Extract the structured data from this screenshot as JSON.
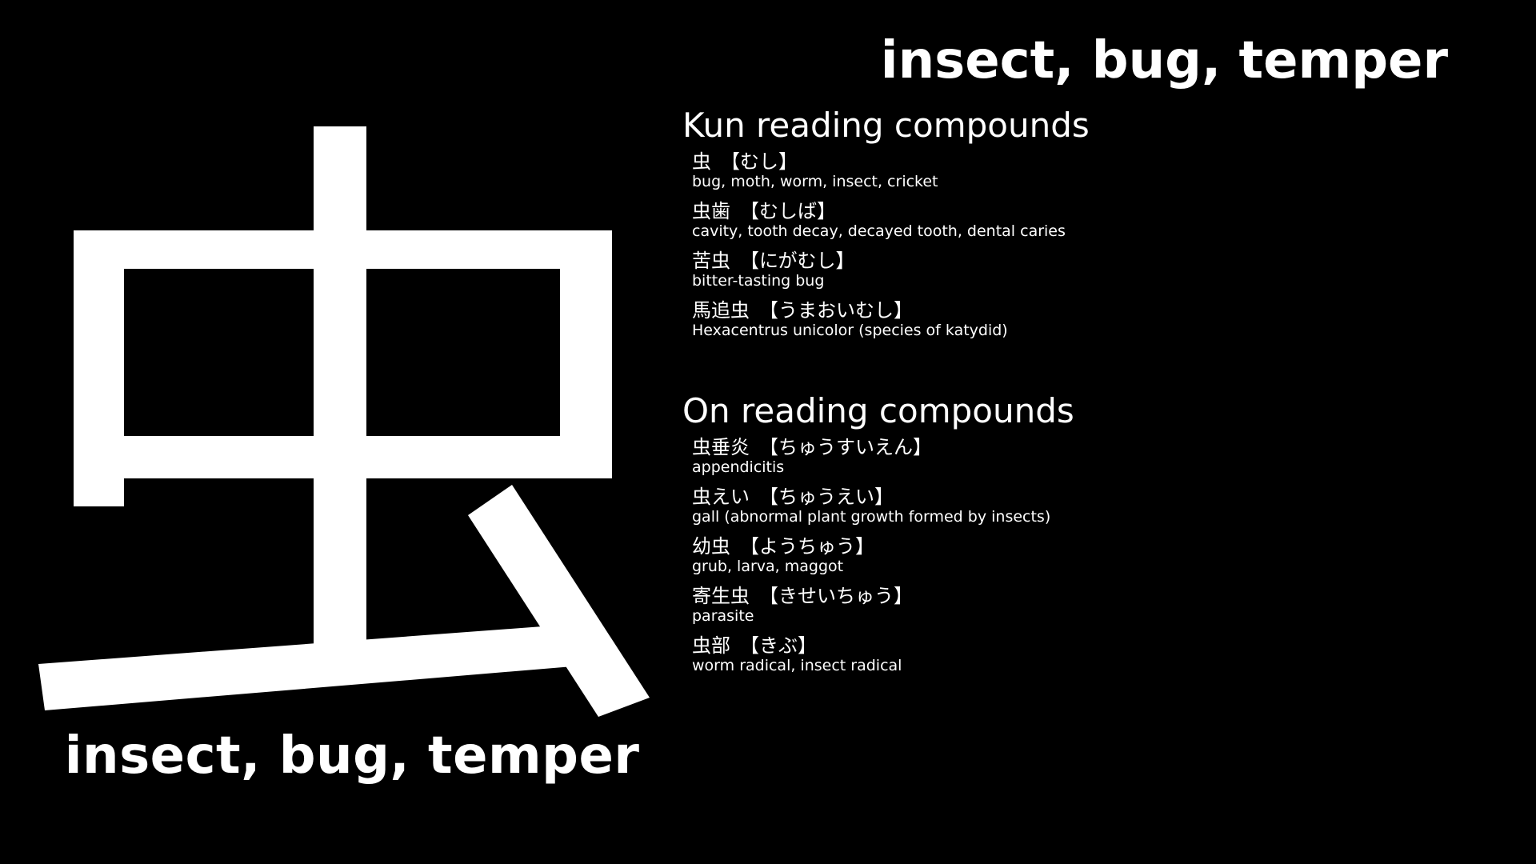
{
  "kanji": {
    "character": "虫",
    "meaning_large": "insect, bug, temper"
  },
  "header": {
    "meaning": "insect, bug, temper"
  },
  "kun_section": {
    "heading": "Kun reading compounds",
    "items": [
      {
        "term": "虫",
        "reading": "【むし】",
        "gloss": "bug, moth, worm, insect, cricket"
      },
      {
        "term": "虫歯",
        "reading": "【むしば】",
        "gloss": "cavity, tooth decay, decayed tooth, dental caries"
      },
      {
        "term": "苦虫",
        "reading": "【にがむし】",
        "gloss": "bitter-tasting bug"
      },
      {
        "term": "馬追虫",
        "reading": "【うまおいむし】",
        "gloss": "Hexacentrus unicolor (species of katydid)"
      }
    ]
  },
  "on_section": {
    "heading": "On reading compounds",
    "items": [
      {
        "term": "虫垂炎",
        "reading": "【ちゅうすいえん】",
        "gloss": "appendicitis"
      },
      {
        "term": "虫えい",
        "reading": "【ちゅうえい】",
        "gloss": "gall (abnormal plant growth formed by insects)"
      },
      {
        "term": "幼虫",
        "reading": "【ようちゅう】",
        "gloss": "grub, larva, maggot"
      },
      {
        "term": "寄生虫",
        "reading": "【きせいちゅう】",
        "gloss": "parasite"
      },
      {
        "term": "虫部",
        "reading": "【きぶ】",
        "gloss": "worm radical, insect radical"
      }
    ]
  },
  "colors": {
    "background": "#000000",
    "text": "#ffffff"
  }
}
